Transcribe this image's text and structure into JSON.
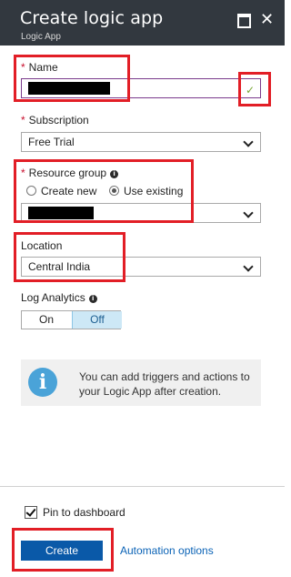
{
  "header": {
    "title": "Create logic app",
    "subtitle": "Logic App",
    "maximize_icon": "maximize-icon",
    "close_icon": "close-icon",
    "close_glyph": "✕"
  },
  "form": {
    "required_mark": "*",
    "name": {
      "label": "Name",
      "value_redacted": true,
      "status_icon": "check-icon",
      "status_glyph": "✓"
    },
    "subscription": {
      "label": "Subscription",
      "value": "Free Trial"
    },
    "resource_group": {
      "label": "Resource group",
      "info_glyph": "i",
      "options": [
        "Create new",
        "Use existing"
      ],
      "selected": "Use existing",
      "value_redacted": true
    },
    "location": {
      "label": "Location",
      "value": "Central India"
    },
    "log_analytics": {
      "label": "Log Analytics",
      "info_glyph": "i",
      "on_label": "On",
      "off_label": "Off",
      "selected": "Off"
    }
  },
  "info_box": {
    "icon": "info-icon",
    "glyph": "i",
    "message": "You can add triggers and actions to your Logic App after creation."
  },
  "footer": {
    "pin_label": "Pin to dashboard",
    "pin_checked": true,
    "create_label": "Create",
    "automation_label": "Automation options"
  },
  "colors": {
    "header_bg": "#32383f",
    "create_button": "#0a59a8",
    "link": "#0b63b6",
    "annotation_red": "#e21e26",
    "valid_check": "#7ba93a"
  }
}
